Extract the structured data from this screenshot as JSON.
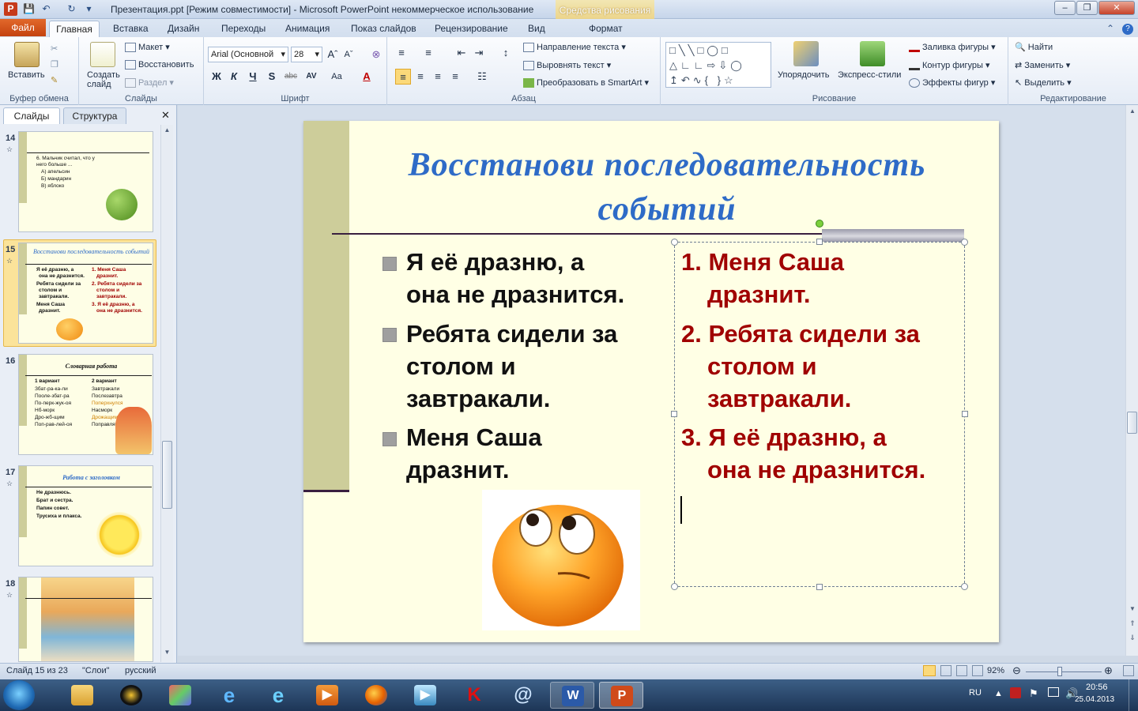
{
  "window": {
    "title": "Презентация.ppt [Режим совместимости] - Microsoft PowerPoint некоммерческое использование",
    "context_tab_group": "Средства рисования"
  },
  "tabs": [
    "Главная",
    "Вставка",
    "Дизайн",
    "Переходы",
    "Анимация",
    "Показ слайдов",
    "Рецензирование",
    "Вид"
  ],
  "file_tab": "Файл",
  "context_tab": "Формат",
  "ribbon": {
    "clipboard": {
      "paste": "Вставить",
      "label": "Буфер обмена"
    },
    "slides": {
      "new_slide": "Создать слайд",
      "layout": "Макет",
      "reset": "Восстановить",
      "section": "Раздел",
      "label": "Слайды"
    },
    "font": {
      "font_name": "Arial (Основной",
      "font_size": "28",
      "label": "Шрифт",
      "bold": "Ж",
      "italic": "К",
      "underline": "Ч",
      "shadow": "S",
      "strike": "abc",
      "spacing": "AV",
      "case": "Aa",
      "color": "A"
    },
    "paragraph": {
      "text_direction": "Направление текста",
      "align_text": "Выровнять текст",
      "smartart": "Преобразовать в SmartArt",
      "label": "Абзац"
    },
    "drawing": {
      "arrange": "Упорядочить",
      "quick_styles": "Экспресс-стили",
      "fill": "Заливка фигуры",
      "outline": "Контур фигуры",
      "effects": "Эффекты фигур",
      "label": "Рисование"
    },
    "editing": {
      "find": "Найти",
      "replace": "Заменить",
      "select": "Выделить",
      "label": "Редактирование"
    }
  },
  "pane": {
    "tab_slides": "Слайды",
    "tab_outline": "Структура"
  },
  "thumbnails": [
    {
      "num": "14",
      "lines": [
        "6. Мальчик считал, что у",
        "него больше ...",
        "А) апельсин",
        "Б) мандарин",
        "В) яблоко"
      ]
    },
    {
      "num": "15",
      "title": "Восстанови последовательность событий",
      "left": [
        "Я её дразню, а",
        "она не дразнится.",
        "Ребята сидели за",
        "столом и",
        "завтракали.",
        "Меня Саша",
        "дразнит."
      ],
      "right": [
        "1. Меня Саша",
        "дразнит.",
        "2. Ребята сидели за",
        "столом и",
        "завтракали.",
        "3. Я её дразню, а",
        "она не дразнится."
      ]
    },
    {
      "num": "16",
      "title": "Словарная работа",
      "col1_head": "1 вариант",
      "col1": [
        "Збат-ра-ка-ли",
        "Пооле-збат-ра",
        "По-перк-жук-оя",
        "Нб-морк",
        "Дро-жб-щим",
        "Поп-рав-лей-оя"
      ],
      "col2_head": "2 вариант",
      "col2": [
        "Завтракали",
        "Послезавтра",
        "Поперхнулся",
        "Насморк",
        "Дрожащим",
        "Поправляйся"
      ]
    },
    {
      "num": "17",
      "title": "Работа с заголовком",
      "lines": [
        "Не дразнюсь.",
        "Брат и сестра.",
        "Папин совет.",
        "Трусиха и плакса."
      ]
    },
    {
      "num": "18"
    }
  ],
  "slide": {
    "title_line1": "Восстанови последовательность",
    "title_line2": "событий",
    "left_items": [
      {
        "l1": "Я её дразню, а",
        "l2": "она не дразнится."
      },
      {
        "l1": "Ребята сидели за",
        "l2": "столом и",
        "l3": "завтракали."
      },
      {
        "l1": "Меня Саша",
        "l2": "дразнит."
      }
    ],
    "right_items": [
      {
        "l1": "1. Меня Саша",
        "l2": "дразнит."
      },
      {
        "l1": "2. Ребята сидели за",
        "l2": "столом и",
        "l3": "завтракали."
      },
      {
        "l1": "3. Я её дразню, а",
        "l2": "она не дразнится."
      }
    ]
  },
  "status": {
    "slide": "Слайд 15 из 23",
    "theme": "\"Слои\"",
    "lang": "русский",
    "zoom": "92%"
  },
  "taskbar": {
    "lang": "RU",
    "time": "20:56",
    "date": "25.04.2013"
  },
  "colors": {
    "accent_title": "#2e6bc7",
    "numbered_text": "#a00000",
    "slide_bg": "#ffffe5",
    "strip": "#cdcd9a"
  }
}
